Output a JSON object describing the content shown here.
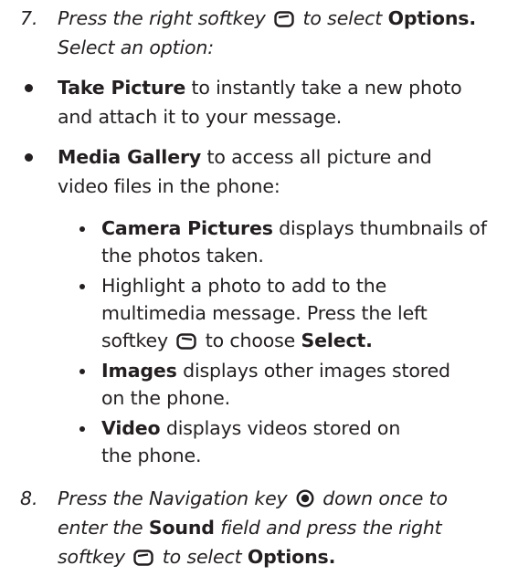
{
  "step7": {
    "number": "7.",
    "pre": "Press the right softkey",
    "icon": "right-softkey-icon",
    "post": "to select",
    "bold": "Options.",
    "line2": "Select an option:"
  },
  "bullets": [
    {
      "bold": "Take Picture",
      "rest1": "to instantly take a new photo",
      "line2": "and attach it to your message."
    },
    {
      "bold": "Media Gallery",
      "rest1": "to access all picture and",
      "line2": "video files in the phone:"
    }
  ],
  "sub_bullets": [
    {
      "bold": "Camera Pictures",
      "rest1": "displays thumbnails of",
      "line2": "the photos taken."
    },
    {
      "line1": "Highlight a photo to add to the",
      "line2": "multimedia message. Press the left",
      "line3_pre": "softkey",
      "line3_icon": "left-softkey-icon",
      "line3_post": "to choose",
      "line3_bold": "Select."
    },
    {
      "bold": "Images",
      "rest1": "displays other images stored",
      "line2": "on the phone."
    },
    {
      "bold": "Video",
      "rest1": "displays videos stored on",
      "line2": "the phone."
    }
  ],
  "step8": {
    "number": "8.",
    "pre": "Press the Navigation key",
    "icon": "navigation-key-icon",
    "post": "down once to",
    "line2_pre": "enter the",
    "line2_bold": "Sound",
    "line2_post": "field and press the right",
    "line3_pre": "softkey",
    "line3_icon": "right-softkey-icon",
    "line3_post": "to select",
    "line3_bold": "Options."
  }
}
